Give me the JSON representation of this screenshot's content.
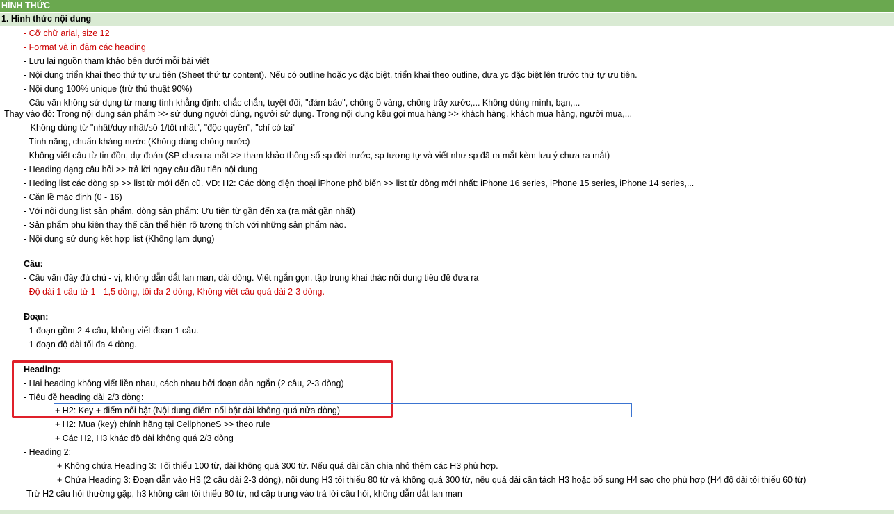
{
  "header": {
    "title": "HÌNH THỨC"
  },
  "section": {
    "title": "1. Hình thức nội dung"
  },
  "lines": [
    "- Cỡ chữ arial, size 12",
    "- Format và in đậm các heading",
    "- Lưu lại nguồn tham khảo bên dưới mỗi bài viết",
    "- Nội dung triển khai theo thứ tự ưu tiên (Sheet thứ tự content). Nếu có outline hoặc yc đặc biệt, triển khai theo outline, đưa yc đặc biệt lên trước thứ tự ưu tiên.",
    "- Nội dung 100% unique (trừ thủ thuật 90%)",
    "- Câu văn không sử dụng từ mang tính khẳng định: chắc chắn, tuyệt đối, \"đảm bảo\", chống ố vàng, chống trầy xước,... Không dùng mình, bạn,...",
    "Thay vào đó: Trong nội dung sản phẩm >> sử dụng người dùng, người sử dụng. Trong nội dung kêu gọi mua hàng >> khách hàng, khách mua hàng, người mua,...",
    " - Không dùng từ \"nhất/duy nhất/số 1/tốt nhất\", \"độc quyền\", \"chỉ có tại\"",
    "- Tính năng, chuẩn kháng nước (Không dùng chống nước)",
    "- Không viết câu từ tin đồn, dự đoán (SP chưa ra mắt >> tham khảo thông số sp đời trước, sp tương tự và viết như sp đã ra mắt kèm lưu ý chưa ra mắt)",
    "- Heading dạng câu hỏi >> trả lời ngay câu đầu tiên nội dung",
    "- Heding list các dòng sp >> list từ mới đến cũ. VD: H2: Các dòng điện thoại iPhone phổ biến >> list từ dòng mới nhất: iPhone 16 series, iPhone 15 series, iPhone 14 series,...",
    "- Căn lề mặc định (0 - 16)",
    "- Với nội dung list sản phẩm, dòng sản phẩm: Ưu tiên từ gần đến xa (ra mắt gần nhất)",
    "- Sản phẩm phụ kiện thay thế cần thể hiện rõ tương thích với những sản phẩm nào.",
    "- Nội dung sử dụng kết hợp list (Không lạm dụng)",
    "Câu:",
    "- Câu văn đầy đủ chủ - vị, không dẫn dắt lan man, dài dòng. Viết ngắn gọn, tập trung khai thác nội dung tiêu đề đưa ra",
    "- Độ dài 1 câu từ 1 - 1,5 dòng, tối đa 2 dòng, Không viết câu quá dài 2-3 dòng.",
    "Đoạn:",
    "- 1 đoạn gồm 2-4 câu, không viết đoạn 1 câu.",
    "- 1 đoạn độ dài tối đa 4 dòng.",
    "Heading:",
    "- Hai heading không viết liền nhau, cách nhau bởi đoạn dẫn ngắn (2 câu, 2-3 dòng)",
    "- Tiêu đề heading dài 2/3 dòng:",
    "+ H2: Key + điểm nổi bật  (Nội dung điểm nổi bật dài không quá nửa dòng)",
    "+ H2: Mua (key) chính hãng tại CellphoneS >> theo rule",
    "+ Các H2, H3 khác độ dài không quá 2/3 dòng",
    "- Heading 2:",
    "+ Không chứa Heading 3: Tối thiểu 100 từ, dài không quá 300 từ. Nếu quá dài cần chia nhỏ thêm các H3 phù hợp.",
    "+ Chứa Heading 3: Đoạn dẫn vào H3 (2 câu dài 2-3 dòng), nội dung H3 tối thiểu 80 từ và không quá 300 từ, nếu quá dài cần tách H3 hoặc bổ sung H4 sao cho phù hợp (H4 độ dài tối thiểu 60 từ)",
    " Trừ H2 câu hỏi thường gặp, h3 không cần tối thiểu 80 từ, nd cập trung vào trả lời câu hỏi, không dẫn dắt lan man"
  ]
}
